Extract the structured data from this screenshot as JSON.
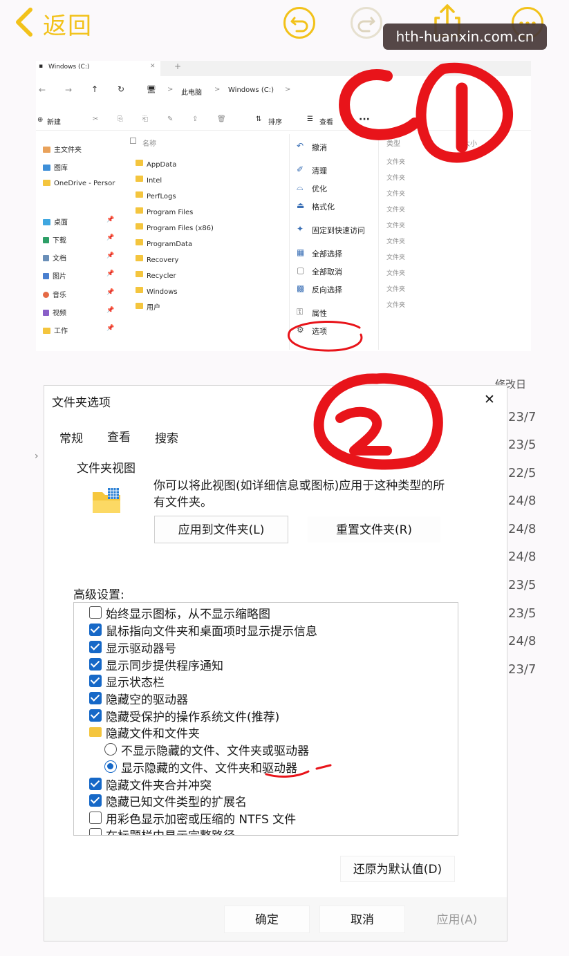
{
  "topbar": {
    "back_label": "返回",
    "watermark": "hth-huanxin.com.cn"
  },
  "explorer": {
    "tab_title": "Windows (C:)",
    "tab_add": "+",
    "nav_back": "←",
    "nav_forward": "→",
    "nav_up": "↑",
    "nav_refresh": "↻",
    "path_sep1": ">",
    "path_sep2": ">",
    "path_sep3": ">",
    "path_this_pc": "此电脑",
    "path_drive": "Windows (C:)",
    "toolbar": {
      "new_label": "新建",
      "sort_label": "排序",
      "view_label": "查看",
      "more_label": "···"
    },
    "sidebar": [
      {
        "label": "主文件夹"
      },
      {
        "label": "图库"
      },
      {
        "label": "OneDrive - Persor"
      },
      {
        "label": "桌面"
      },
      {
        "label": "下载"
      },
      {
        "label": "文档"
      },
      {
        "label": "图片"
      },
      {
        "label": "音乐"
      },
      {
        "label": "视频"
      },
      {
        "label": "工作"
      }
    ],
    "columns": {
      "name": "名称",
      "type": "类型",
      "size": "大小"
    },
    "files": [
      {
        "name": "AppData",
        "type": "文件夹"
      },
      {
        "name": "Intel",
        "type": "文件夹"
      },
      {
        "name": "PerfLogs",
        "type": "文件夹"
      },
      {
        "name": "Program Files",
        "type": "文件夹"
      },
      {
        "name": "Program Files (x86)",
        "type": "文件夹"
      },
      {
        "name": "ProgramData",
        "type": "文件夹"
      },
      {
        "name": "Recovery",
        "type": "文件夹"
      },
      {
        "name": "Recycler",
        "type": "文件夹"
      },
      {
        "name": "Windows",
        "type": "文件夹"
      },
      {
        "name": "用户",
        "type": "文件夹"
      }
    ],
    "context_menu": [
      {
        "label": "撤消"
      },
      {
        "label": "清理"
      },
      {
        "label": "优化"
      },
      {
        "label": "格式化"
      },
      {
        "label": "固定到快速访问"
      },
      {
        "label": "全部选择"
      },
      {
        "label": "全部取消"
      },
      {
        "label": "反向选择"
      },
      {
        "label": "属性"
      },
      {
        "label": "选项"
      }
    ]
  },
  "dialog": {
    "title": "文件夹选项",
    "close": "✕",
    "tabs": [
      {
        "label": "常规"
      },
      {
        "label": "查看"
      },
      {
        "label": "搜索"
      }
    ],
    "folder_view_heading": "文件夹视图",
    "folder_view_desc_line1": "你可以将此视图(如详细信息或图标)应用于这种类型的所",
    "folder_view_desc_line2": "有文件夹。",
    "apply_to_folders": "应用到文件夹(L)",
    "reset_folders": "重置文件夹(R)",
    "advanced_heading": "高级设置:",
    "settings": [
      {
        "label": "始终显示图标，从不显示缩略图",
        "state": "unchecked"
      },
      {
        "label": "鼠标指向文件夹和桌面项时显示提示信息",
        "state": "checked"
      },
      {
        "label": "显示驱动器号",
        "state": "checked"
      },
      {
        "label": "显示同步提供程序通知",
        "state": "checked"
      },
      {
        "label": "显示状态栏",
        "state": "checked"
      },
      {
        "label": "隐藏空的驱动器",
        "state": "checked"
      },
      {
        "label": "隐藏受保护的操作系统文件(推荐)",
        "state": "checked"
      },
      {
        "label": "隐藏文件和文件夹",
        "state": "folder"
      },
      {
        "label": "不显示隐藏的文件、文件夹或驱动器",
        "state": "radio-off"
      },
      {
        "label": "显示隐藏的文件、文件夹和驱动器",
        "state": "radio-on"
      },
      {
        "label": "隐藏文件夹合并冲突",
        "state": "checked"
      },
      {
        "label": "隐藏已知文件类型的扩展名",
        "state": "checked"
      },
      {
        "label": "用彩色显示加密或压缩的 NTFS 文件",
        "state": "unchecked"
      },
      {
        "label": "在标题栏中显示完整路径",
        "state": "unchecked"
      }
    ],
    "restore_defaults": "还原为默认值(D)",
    "ok": "确定",
    "cancel": "取消",
    "apply": "应用(A)"
  },
  "background_column": {
    "header": "修改日",
    "dates": [
      "23/7",
      "23/5",
      "22/5",
      "24/8",
      "24/8",
      "24/8",
      "23/5",
      "23/5",
      "24/8",
      "23/7"
    ]
  },
  "colors": {
    "accent": "#f2c21a",
    "checkbox": "#1668c7",
    "annotation": "#e8141a",
    "folder": "#f4c53e"
  }
}
